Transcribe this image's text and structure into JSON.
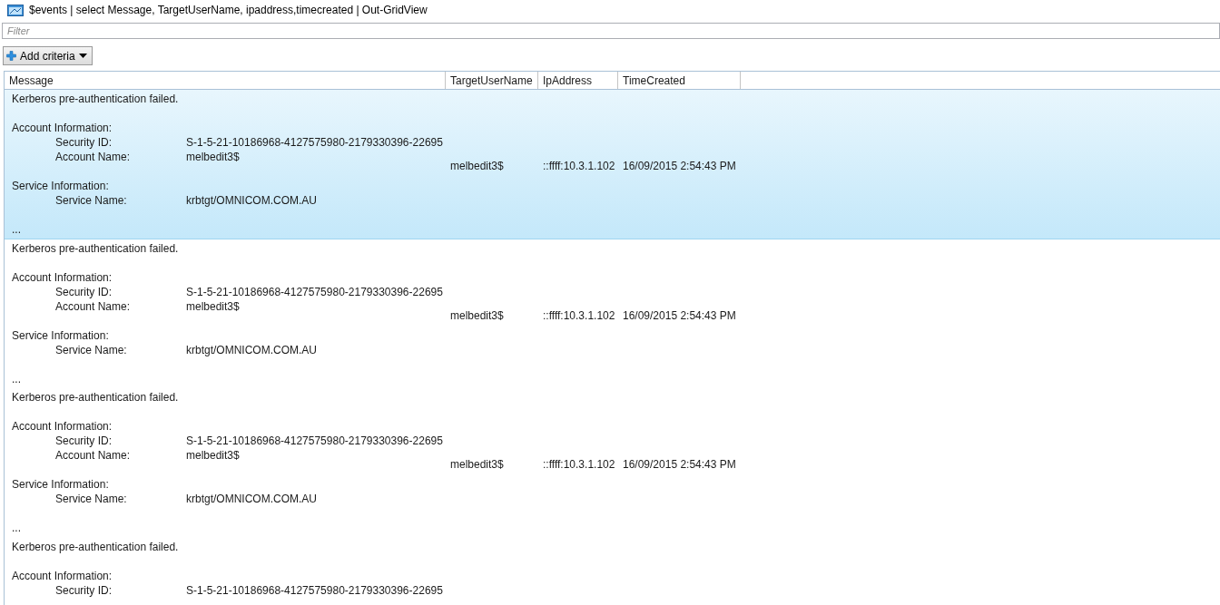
{
  "window": {
    "title": "$events | select Message, TargetUserName, ipaddress,timecreated | Out-GridView"
  },
  "filter": {
    "placeholder": "Filter"
  },
  "add_criteria_button": {
    "label": "Add criteria"
  },
  "table": {
    "columns": [
      "Message",
      "TargetUserName",
      "IpAddress",
      "TimeCreated"
    ],
    "rows": [
      {
        "selected": true,
        "message": {
          "summary": "Kerberos pre-authentication failed.",
          "sections": [
            {
              "heading": "Account Information:",
              "fields": [
                {
                  "label": "Security ID:",
                  "value": "S-1-5-21-10186968-4127575980-2179330396-22695"
                },
                {
                  "label": "Account Name:",
                  "value": "melbedit3$"
                }
              ]
            },
            {
              "heading": "Service Information:",
              "fields": [
                {
                  "label": "Service Name:",
                  "value": "krbtgt/OMNICOM.COM.AU"
                }
              ]
            }
          ],
          "trailer": "..."
        },
        "target_user_name": "melbedit3$",
        "ip_address": "::ffff:10.3.1.102",
        "time_created": "16/09/2015 2:54:43 PM"
      },
      {
        "selected": false,
        "message": {
          "summary": "Kerberos pre-authentication failed.",
          "sections": [
            {
              "heading": "Account Information:",
              "fields": [
                {
                  "label": "Security ID:",
                  "value": "S-1-5-21-10186968-4127575980-2179330396-22695"
                },
                {
                  "label": "Account Name:",
                  "value": "melbedit3$"
                }
              ]
            },
            {
              "heading": "Service Information:",
              "fields": [
                {
                  "label": "Service Name:",
                  "value": "krbtgt/OMNICOM.COM.AU"
                }
              ]
            }
          ],
          "trailer": "..."
        },
        "target_user_name": "melbedit3$",
        "ip_address": "::ffff:10.3.1.102",
        "time_created": "16/09/2015 2:54:43 PM"
      },
      {
        "selected": false,
        "message": {
          "summary": "Kerberos pre-authentication failed.",
          "sections": [
            {
              "heading": "Account Information:",
              "fields": [
                {
                  "label": "Security ID:",
                  "value": "S-1-5-21-10186968-4127575980-2179330396-22695"
                },
                {
                  "label": "Account Name:",
                  "value": "melbedit3$"
                }
              ]
            },
            {
              "heading": "Service Information:",
              "fields": [
                {
                  "label": "Service Name:",
                  "value": "krbtgt/OMNICOM.COM.AU"
                }
              ]
            }
          ],
          "trailer": "..."
        },
        "target_user_name": "melbedit3$",
        "ip_address": "::ffff:10.3.1.102",
        "time_created": "16/09/2015 2:54:43 PM"
      },
      {
        "selected": false,
        "message": {
          "summary": "Kerberos pre-authentication failed.",
          "sections": [
            {
              "heading": "Account Information:",
              "fields": [
                {
                  "label": "Security ID:",
                  "value": "S-1-5-21-10186968-4127575980-2179330396-22695"
                }
              ]
            }
          ]
        }
      }
    ]
  }
}
